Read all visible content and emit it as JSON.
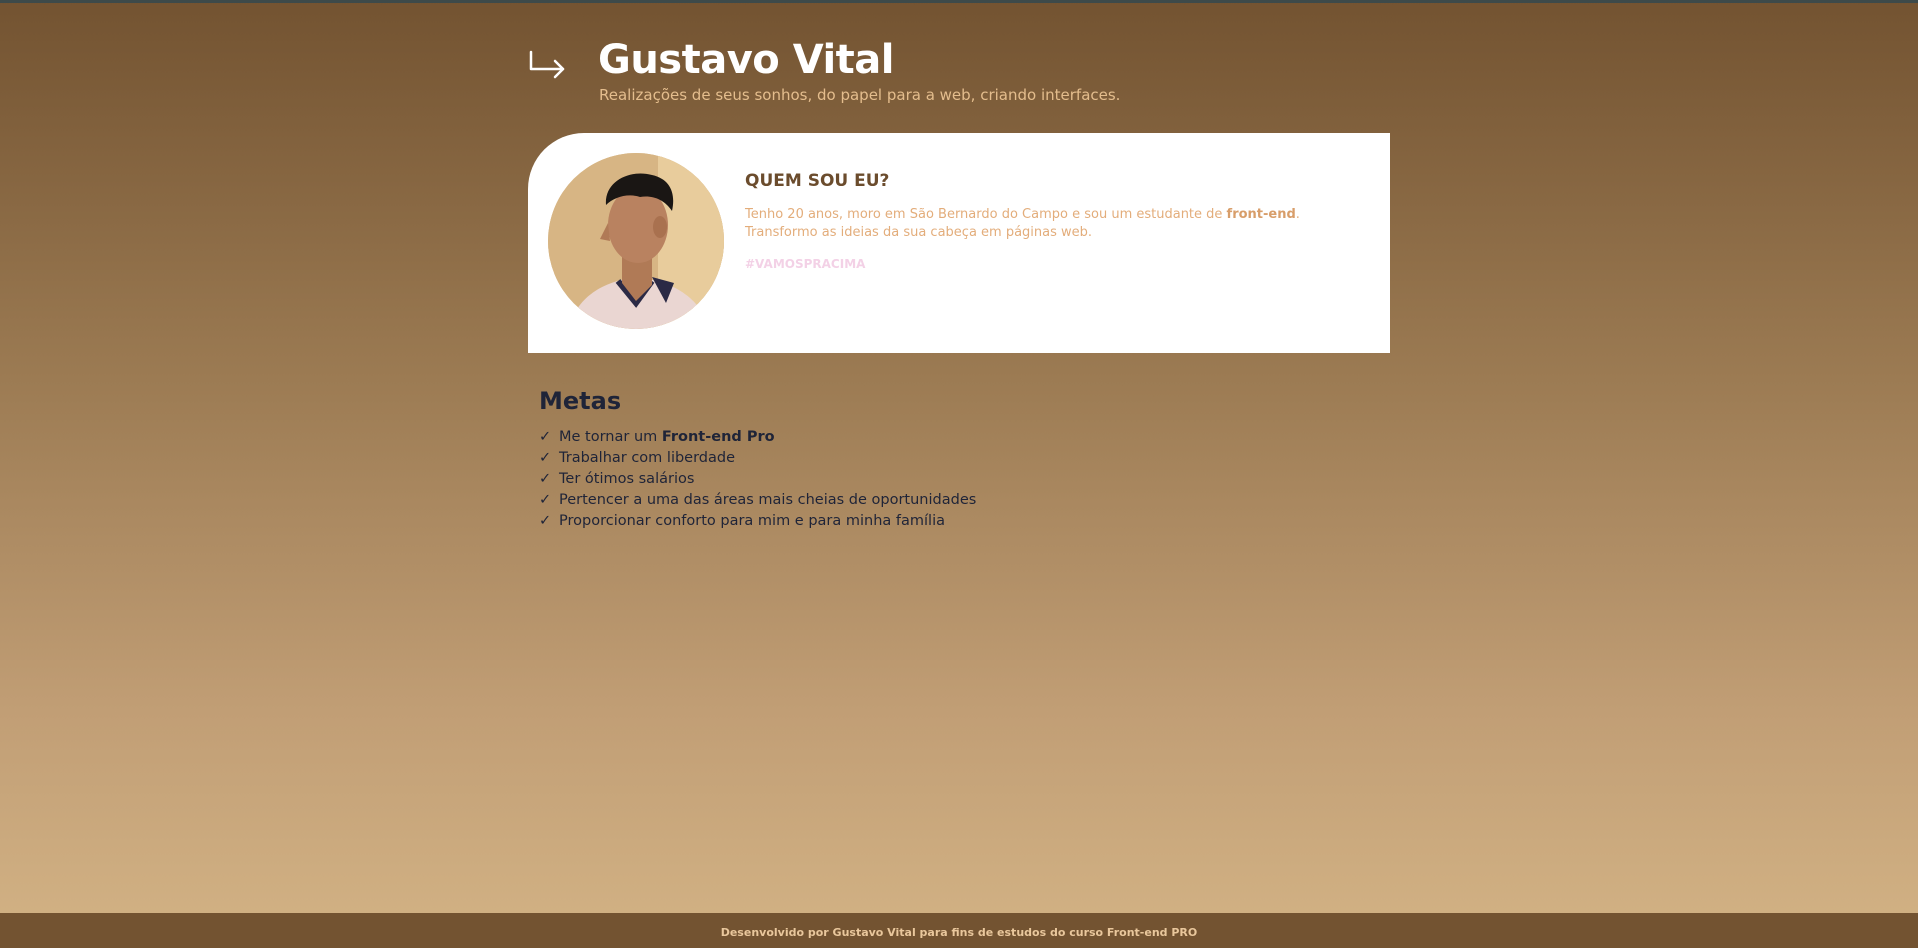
{
  "header": {
    "icon": "arrow-down-right-icon",
    "title": "Gustavo Vital",
    "subtitle": "Realizações de seus sonhos, do papel para a web, criando interfaces."
  },
  "about": {
    "heading": "QUEM SOU EU?",
    "text_part1": "Tenho 20 anos, moro em São Bernardo do Campo e sou um estudante de ",
    "text_bold": "front-end",
    "text_part2": ". Transformo as ideias da sua cabeça em páginas web.",
    "hashtag": "#VAMOSPRACIMA",
    "avatar": "profile-photo"
  },
  "goals": {
    "title": "Metas",
    "check_symbol": "✓",
    "items": [
      {
        "text": "Me tornar um ",
        "bold": "Front-end Pro"
      },
      {
        "text": "Trabalhar com liberdade",
        "bold": ""
      },
      {
        "text": "Ter ótimos salários",
        "bold": ""
      },
      {
        "text": "Pertencer a uma das áreas mais cheias de oportunidades",
        "bold": ""
      },
      {
        "text": "Proporcionar conforto para mim e para minha família",
        "bold": ""
      }
    ]
  },
  "footer": {
    "text": "Desenvolvido por Gustavo Vital para fins de estudos do curso Front-end PRO"
  },
  "colors": {
    "background_top": "#735331",
    "background_bottom": "#d3b385",
    "footer_bg": "#735331",
    "accent": "#e3ad7b",
    "heading_dark": "#6b4c2d",
    "goals_text": "#1f2438"
  }
}
